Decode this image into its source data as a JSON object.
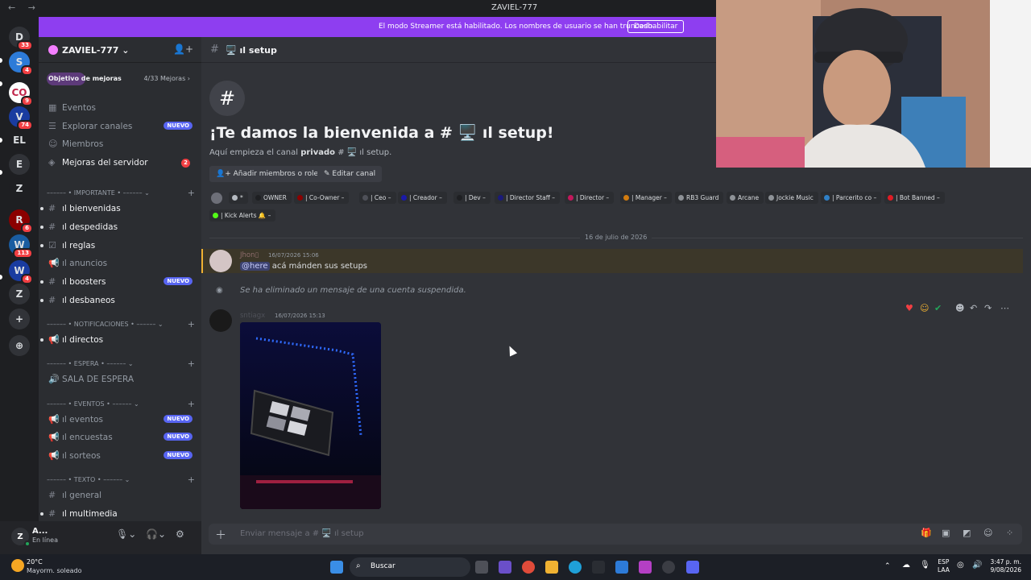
{
  "titlebar": {
    "nav": "← →",
    "title": "ZAVIEL-777"
  },
  "banner": {
    "text": "El modo Streamer está habilitado. Los nombres de usuario se han truncado.",
    "button": "Deshabilitar"
  },
  "servers": [
    {
      "label": "D",
      "badge": "33"
    },
    {
      "label": "S",
      "badge": "4"
    },
    {
      "label": "CO",
      "badge": "9"
    },
    {
      "label": "V",
      "badge": "74"
    },
    {
      "label": "EL",
      "badge": ""
    },
    {
      "label": "E",
      "badge": ""
    },
    {
      "label": "Z",
      "badge": ""
    },
    {
      "label": "R",
      "badge": "6"
    },
    {
      "label": "W",
      "badge": "113"
    },
    {
      "label": "W",
      "badge": "4"
    },
    {
      "label": "Z",
      "badge": ""
    },
    {
      "label": "+",
      "badge": ""
    },
    {
      "label": "⊕",
      "badge": ""
    }
  ],
  "guild": {
    "name": "ZAVIEL-777 ⌄"
  },
  "boost": {
    "label": "Objetivo de mejoras",
    "count": "4/33 Mejoras ›"
  },
  "menu": [
    {
      "label": "Eventos"
    },
    {
      "label": "Explorar canales",
      "tag": "NUEVO"
    },
    {
      "label": "Miembros"
    },
    {
      "label": "Mejoras del servidor",
      "count": "2"
    }
  ],
  "categories": {
    "importante": "–––––– • IMPORTANTE • –––––– ⌄",
    "notificaciones": "–––––– • NOTIFICACIONES • –––––– ⌄",
    "espera": "–––––– • ESPERA • –––––– ⌄",
    "eventos": "–––––– • EVENTOS • –––––– ⌄",
    "texto": "–––––– • TEXTO • –––––– ⌄"
  },
  "channels": {
    "bienvenidas": "ıl bienvenidas",
    "despedidas": "ıl despedidas",
    "reglas": "ıl reglas",
    "anuncios": "ıl anuncios",
    "boosters": "ıl boosters",
    "desbaneos": "ıl desbaneos",
    "directos": "ıl directos",
    "sala": "SALA DE ESPERA",
    "eventos": "ıl eventos",
    "encuestas": "ıl encuestas",
    "sorteos": "ıl sorteos",
    "general": "ıl general",
    "multimedia": "ıl multimedia",
    "new_tag": "NUEVO"
  },
  "user": {
    "name": "A...",
    "status": "En línea"
  },
  "channel": {
    "name": "🖥️ ıl setup"
  },
  "welcome": {
    "title": "¡Te damos la bienvenida a # 🖥️ ıl setup!",
    "sub_pre": "Aquí empieza el canal ",
    "sub_bold": "privado",
    "sub_post": " # 🖥️ ıl setup.",
    "btn_add": "Añadir miembros o roles",
    "btn_edit": "Editar canal"
  },
  "roles": [
    {
      "name": "*",
      "color": "#b5bac1"
    },
    {
      "name": "OWNER",
      "color": "#1e1f22"
    },
    {
      "name": "| Co-Owner –",
      "color": "#8b0000"
    },
    {
      "name": "| Ceo –",
      "color": "#4e5058"
    },
    {
      "name": "| Creador –",
      "color": "#1a1aa8"
    },
    {
      "name": "| Dev –",
      "color": "#1e1f22"
    },
    {
      "name": "| Director Staff –",
      "color": "#1a1a7a"
    },
    {
      "name": "| Director –",
      "color": "#c2185b"
    },
    {
      "name": "| Manager –",
      "color": "#d17b0f"
    },
    {
      "name": "RB3 Guard",
      "color": "#8e9297"
    },
    {
      "name": "Arcane",
      "color": "#8e9297"
    },
    {
      "name": "Jockie Music",
      "color": "#8e9297"
    },
    {
      "name": "| Parcerito co –",
      "color": "#2f80c7"
    },
    {
      "name": "| Bot Banned –",
      "color": "#e01b24"
    },
    {
      "name": "| Kick Alerts 🔔 –",
      "color": "#53fc18"
    }
  ],
  "date_divider": "16 de julio de 2026",
  "messages": {
    "m1": {
      "author": "Jhon▯",
      "time": "16/07/2026 15:06",
      "mention": "@here",
      "text": " acá mánden sus setups"
    },
    "system": "Se ha eliminado un mensaje de una cuenta suspendida.",
    "m2": {
      "author": "sntiagx",
      "time": "16/07/2026 15:13"
    }
  },
  "composer": {
    "placeholder": "Enviar mensaje a # 🖥️ ıl setup"
  },
  "taskbar": {
    "weather_temp": "20°C",
    "weather_desc": "Mayorm. soleado",
    "search": "Buscar",
    "lang": "ESP\nLAA",
    "time": "3:47 p. m.",
    "date": "9/08/2026"
  },
  "colors": {
    "streamer_banner": "#8e3ef0",
    "mention_bg": "#3c3729",
    "nuevo_tag": "#5865f2"
  }
}
